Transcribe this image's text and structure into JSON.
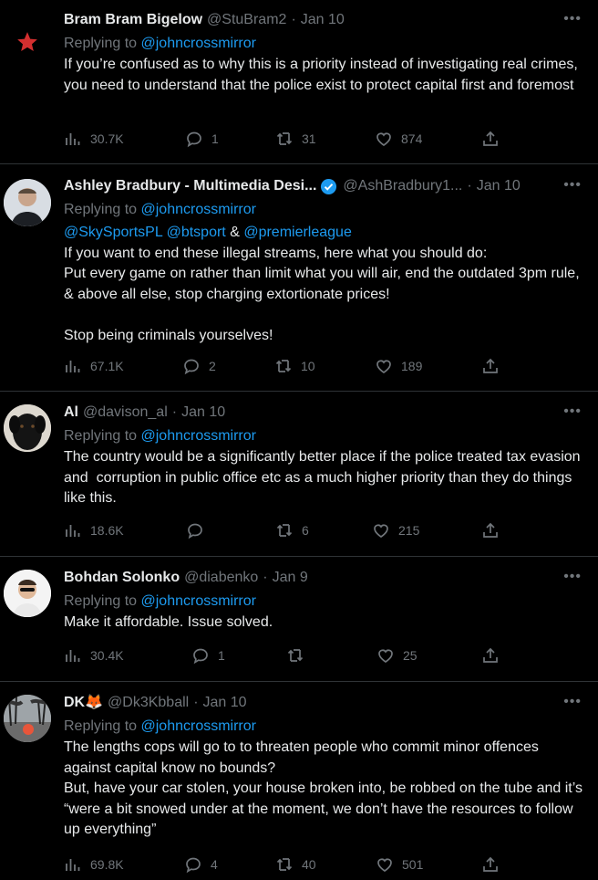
{
  "replying_label": "Replying to",
  "tweets": [
    {
      "name": "Bram Bram Bigelow",
      "handle": "@StuBram2",
      "date": "Jan 10",
      "reply_to": "@johncrossmirror",
      "text": "If you’re confused as to why this is a priority instead of investigating real crimes, you need to understand that the police exist to protect capital first and foremost",
      "views": "30.7K",
      "replies": "1",
      "retweets": "31",
      "likes": "874"
    },
    {
      "name": "Ashley Bradbury - Multimedia Desi...",
      "handle": "@AshBradbury1...",
      "date": "Jan 10",
      "reply_to": "@johncrossmirror",
      "mentions": [
        "@SkySportsPL",
        "@btsport",
        "&",
        "@premierleague"
      ],
      "text": "If you want to end these illegal streams, here what you should do:\nPut every game on rather than limit what you will air, end the outdated 3pm rule, & above all else, stop charging extortionate prices!\n\nStop being criminals yourselves!",
      "views": "67.1K",
      "replies": "2",
      "retweets": "10",
      "likes": "189"
    },
    {
      "name": "Al",
      "handle": "@davison_al",
      "date": "Jan 10",
      "reply_to": "@johncrossmirror",
      "text": "The country would be a significantly better place if the police treated tax evasion and  corruption in public office etc as a much higher priority than they do things like this.",
      "views": "18.6K",
      "replies": "",
      "retweets": "6",
      "likes": "215"
    },
    {
      "name": "Bohdan Solonko",
      "handle": "@diabenko",
      "date": "Jan 9",
      "reply_to": "@johncrossmirror",
      "text": "Make it affordable. Issue solved.",
      "views": "30.4K",
      "replies": "1",
      "retweets": "",
      "likes": "25"
    },
    {
      "name": "DK🦊",
      "handle": "@Dk3Kbball",
      "date": "Jan 10",
      "reply_to": "@johncrossmirror",
      "text": "The lengths cops will go to to threaten people who commit minor offences against capital know no bounds?\nBut, have your car stolen, your house broken into, be robbed on the tube and it’s “were a bit snowed under at the moment, we don’t have the resources to follow up everything”",
      "views": "69.8K",
      "replies": "4",
      "retweets": "40",
      "likes": "501"
    }
  ]
}
